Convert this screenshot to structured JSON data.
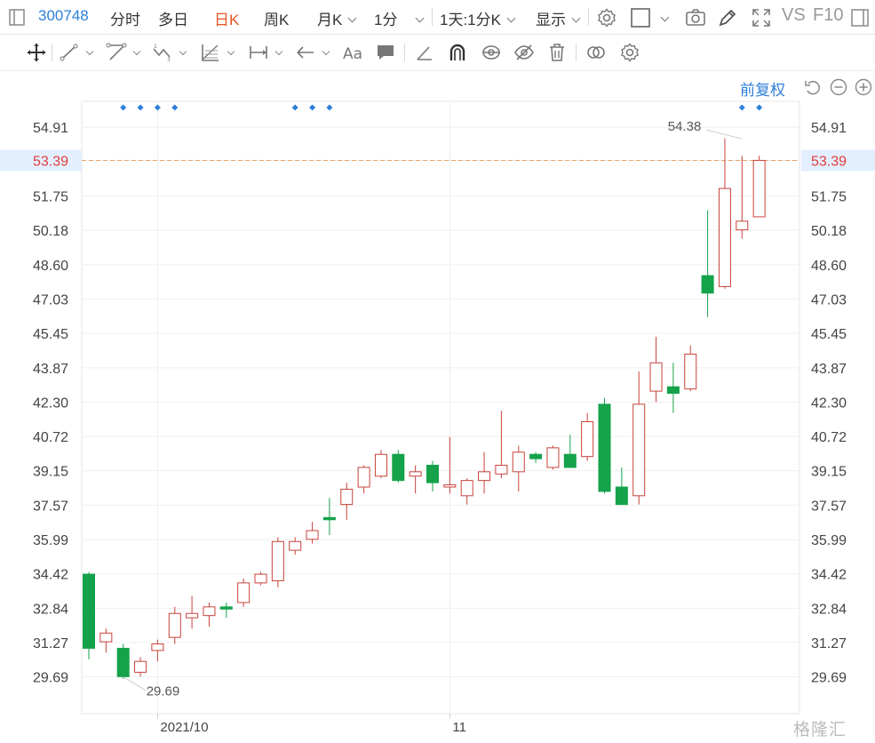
{
  "toolbar": {
    "symbol": "300748",
    "tabs": [
      "分时",
      "多日",
      "日K",
      "周K",
      "月K"
    ],
    "active_tab": "日K",
    "interval": "1分",
    "range": "1天:1分K",
    "display": "显示",
    "vs": "VS",
    "f10": "F10"
  },
  "controls": {
    "restore_label": "前复权"
  },
  "watermark": "格隆汇",
  "colors": {
    "up": "#c8423c",
    "down": "#15a24a",
    "accent": "#2e7fd9",
    "last_price": "#e8541e"
  },
  "chart_data": {
    "type": "candlestick",
    "y_ticks": [
      "54.91",
      "53.39",
      "51.75",
      "50.18",
      "48.60",
      "47.03",
      "45.45",
      "43.87",
      "42.30",
      "40.72",
      "39.15",
      "37.57",
      "35.99",
      "34.42",
      "32.84",
      "31.27",
      "29.69"
    ],
    "ylim": [
      28.0,
      56.1
    ],
    "last_price": "53.39",
    "x_labels": [
      {
        "label": "2021/10",
        "index": 4
      },
      {
        "label": "11",
        "index": 21
      }
    ],
    "high_marker": {
      "label": "54.38",
      "index": 38
    },
    "low_marker": {
      "label": "29.69",
      "index": 2
    },
    "event_dot_indices": [
      2,
      3,
      4,
      5,
      12,
      13,
      14,
      38,
      39
    ],
    "candles": [
      {
        "o": 34.4,
        "h": 34.5,
        "l": 30.5,
        "c": 31.0
      },
      {
        "o": 31.3,
        "h": 31.9,
        "l": 30.8,
        "c": 31.7
      },
      {
        "o": 31.0,
        "h": 31.2,
        "l": 29.6,
        "c": 29.7
      },
      {
        "o": 29.9,
        "h": 30.6,
        "l": 29.7,
        "c": 30.4
      },
      {
        "o": 30.9,
        "h": 31.4,
        "l": 30.4,
        "c": 31.2
      },
      {
        "o": 31.5,
        "h": 32.9,
        "l": 31.2,
        "c": 32.6
      },
      {
        "o": 32.4,
        "h": 33.4,
        "l": 31.9,
        "c": 32.6
      },
      {
        "o": 32.5,
        "h": 33.1,
        "l": 32.0,
        "c": 32.9
      },
      {
        "o": 32.9,
        "h": 33.1,
        "l": 32.4,
        "c": 32.8
      },
      {
        "o": 33.1,
        "h": 34.2,
        "l": 32.9,
        "c": 34.0
      },
      {
        "o": 34.0,
        "h": 34.5,
        "l": 33.9,
        "c": 34.4
      },
      {
        "o": 34.1,
        "h": 36.1,
        "l": 33.8,
        "c": 35.9
      },
      {
        "o": 35.5,
        "h": 36.1,
        "l": 35.3,
        "c": 35.9
      },
      {
        "o": 36.0,
        "h": 36.8,
        "l": 35.8,
        "c": 36.4
      },
      {
        "o": 37.0,
        "h": 37.9,
        "l": 36.2,
        "c": 36.9
      },
      {
        "o": 37.6,
        "h": 38.6,
        "l": 36.9,
        "c": 38.3
      },
      {
        "o": 38.4,
        "h": 39.4,
        "l": 38.1,
        "c": 39.3
      },
      {
        "o": 38.9,
        "h": 40.1,
        "l": 38.8,
        "c": 39.9
      },
      {
        "o": 39.9,
        "h": 40.1,
        "l": 38.6,
        "c": 38.7
      },
      {
        "o": 38.9,
        "h": 39.4,
        "l": 38.1,
        "c": 39.1
      },
      {
        "o": 39.4,
        "h": 39.6,
        "l": 38.2,
        "c": 38.6
      },
      {
        "o": 38.4,
        "h": 40.7,
        "l": 38.1,
        "c": 38.5
      },
      {
        "o": 38.0,
        "h": 38.8,
        "l": 37.6,
        "c": 38.7
      },
      {
        "o": 38.7,
        "h": 40.0,
        "l": 38.1,
        "c": 39.1
      },
      {
        "o": 39.0,
        "h": 41.9,
        "l": 38.8,
        "c": 39.4
      },
      {
        "o": 39.1,
        "h": 40.3,
        "l": 38.2,
        "c": 40.0
      },
      {
        "o": 39.9,
        "h": 40.0,
        "l": 39.5,
        "c": 39.7
      },
      {
        "o": 39.3,
        "h": 40.3,
        "l": 39.2,
        "c": 40.2
      },
      {
        "o": 39.9,
        "h": 40.8,
        "l": 39.3,
        "c": 39.3
      },
      {
        "o": 39.8,
        "h": 41.8,
        "l": 39.6,
        "c": 41.4
      },
      {
        "o": 42.2,
        "h": 42.5,
        "l": 38.1,
        "c": 38.2
      },
      {
        "o": 38.4,
        "h": 39.3,
        "l": 37.6,
        "c": 37.6
      },
      {
        "o": 38.0,
        "h": 43.7,
        "l": 37.6,
        "c": 42.2
      },
      {
        "o": 42.8,
        "h": 45.3,
        "l": 42.3,
        "c": 44.1
      },
      {
        "o": 43.0,
        "h": 44.1,
        "l": 41.8,
        "c": 42.7
      },
      {
        "o": 42.9,
        "h": 44.9,
        "l": 42.8,
        "c": 44.5
      },
      {
        "o": 48.1,
        "h": 51.1,
        "l": 46.2,
        "c": 47.3
      },
      {
        "o": 47.6,
        "h": 54.4,
        "l": 47.5,
        "c": 52.1
      },
      {
        "o": 50.2,
        "h": 53.6,
        "l": 49.8,
        "c": 50.6
      },
      {
        "o": 50.8,
        "h": 53.6,
        "l": 50.8,
        "c": 53.39
      }
    ]
  }
}
